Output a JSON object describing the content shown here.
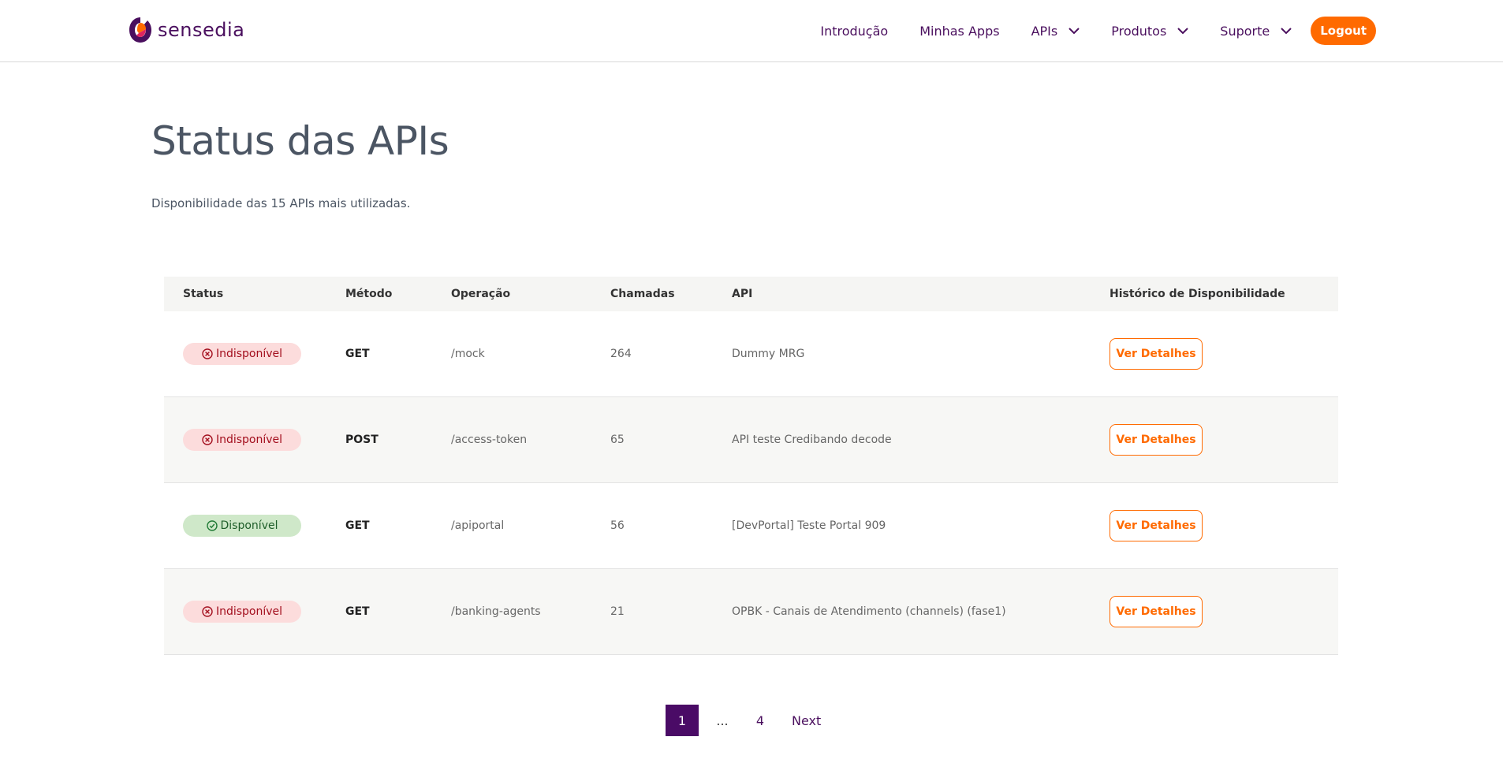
{
  "header": {
    "logo_text": "sensedia",
    "nav": [
      {
        "label": "Introdução",
        "dropdown": false
      },
      {
        "label": "Minhas Apps",
        "dropdown": false
      },
      {
        "label": "APIs",
        "dropdown": true
      },
      {
        "label": "Produtos",
        "dropdown": true
      },
      {
        "label": "Suporte",
        "dropdown": true
      }
    ],
    "logout_label": "Logout"
  },
  "page": {
    "title": "Status das APIs",
    "subtitle": "Disponibilidade das 15 APIs mais utilizadas."
  },
  "table": {
    "headers": {
      "status": "Status",
      "method": "Método",
      "operation": "Operação",
      "calls": "Chamadas",
      "api": "API",
      "history": "Histórico de Disponibilidade"
    },
    "rows": [
      {
        "status": "Indisponível",
        "status_type": "down",
        "method": "GET",
        "operation": "/mock",
        "calls": "264",
        "api": "Dummy MRG",
        "action": "Ver Detalhes"
      },
      {
        "status": "Indisponível",
        "status_type": "down",
        "method": "POST",
        "operation": "/access-token",
        "calls": "65",
        "api": "API teste Credibando decode",
        "action": "Ver Detalhes"
      },
      {
        "status": "Disponível",
        "status_type": "up",
        "method": "GET",
        "operation": "/apiportal",
        "calls": "56",
        "api": "[DevPortal] Teste Portal 909",
        "action": "Ver Detalhes"
      },
      {
        "status": "Indisponível",
        "status_type": "down",
        "method": "GET",
        "operation": "/banking-agents",
        "calls": "21",
        "api": "OPBK - Canais de Atendimento (channels) (fase1)",
        "action": "Ver Detalhes"
      }
    ]
  },
  "pagination": {
    "current": "1",
    "ellipsis": "...",
    "last": "4",
    "next_label": "Next"
  },
  "colors": {
    "brand": "#4a0f5e",
    "accent": "#ff6a00",
    "status_down_bg": "#fcdcdc",
    "status_up_bg": "#cfe8c9"
  },
  "icons": {
    "down": "x-circle-icon",
    "up": "check-circle-icon",
    "nav_dropdown": "chevron-down-icon"
  }
}
